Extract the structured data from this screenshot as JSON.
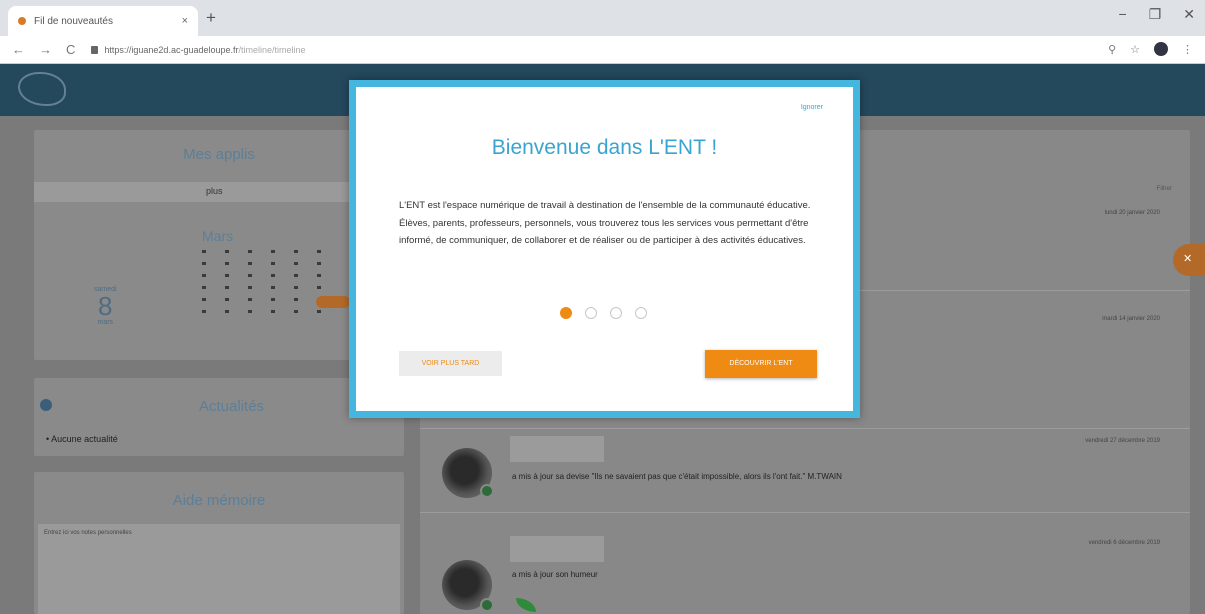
{
  "browser": {
    "tab_title": "Fil de nouveautés",
    "tab_close": "×",
    "new_tab": "+",
    "url_main": "https://iguane2d.ac-guadeloupe.fr",
    "url_path": "/timeline/timeline",
    "window_controls": [
      "−",
      "❐",
      "✕"
    ],
    "nav_buttons": [
      "←",
      "→",
      "C"
    ],
    "toolbar_icons": [
      "⚲",
      "☆",
      "⋮"
    ]
  },
  "sidebar": {
    "apps_title": "Mes applis",
    "apps_search": "plus",
    "calendar_month": "Mars",
    "calendar_weekday": "samedi",
    "calendar_day": "8",
    "calendar_month_small": "mars",
    "news_title": "Actualités",
    "news_empty": "Aucune actualité",
    "memo_title": "Aide mémoire",
    "memo_placeholder": "Entrez ici vos notes personnelles"
  },
  "feed": {
    "filter_label": "Filtrer",
    "dates": [
      "lundi 20 janvier 2020",
      "mardi 14 janvier 2020",
      "vendredi 27 décembre 2019",
      "vendredi 6 décembre 2019"
    ],
    "item1_text": "a mis à jour sa devise \"Ils ne savaient pas que c'était impossible, alors ils l'ont fait.\" M.TWAIN",
    "item2_text": "a mis à jour son humeur"
  },
  "modal": {
    "ignore": "Ignorer",
    "title": "Bienvenue dans L'ENT !",
    "body": "L'ENT est l'espace numérique de travail à destination de l'ensemble de la communauté éducative. Élèves, parents, professeurs, personnels, vous trouverez tous les services vous permettant d'être informé, de communiquer, de collaborer et de réaliser ou de participer à des activités éducatives.",
    "later_button": "VOIR PLUS TARD",
    "discover_button": "DÉCOUVRIR L'ENT",
    "steps_total": 4,
    "step_current": 1
  },
  "colors": {
    "accent_orange": "#ef8a12",
    "accent_blue": "#3aa4d0",
    "header_dark": "#24485c"
  }
}
